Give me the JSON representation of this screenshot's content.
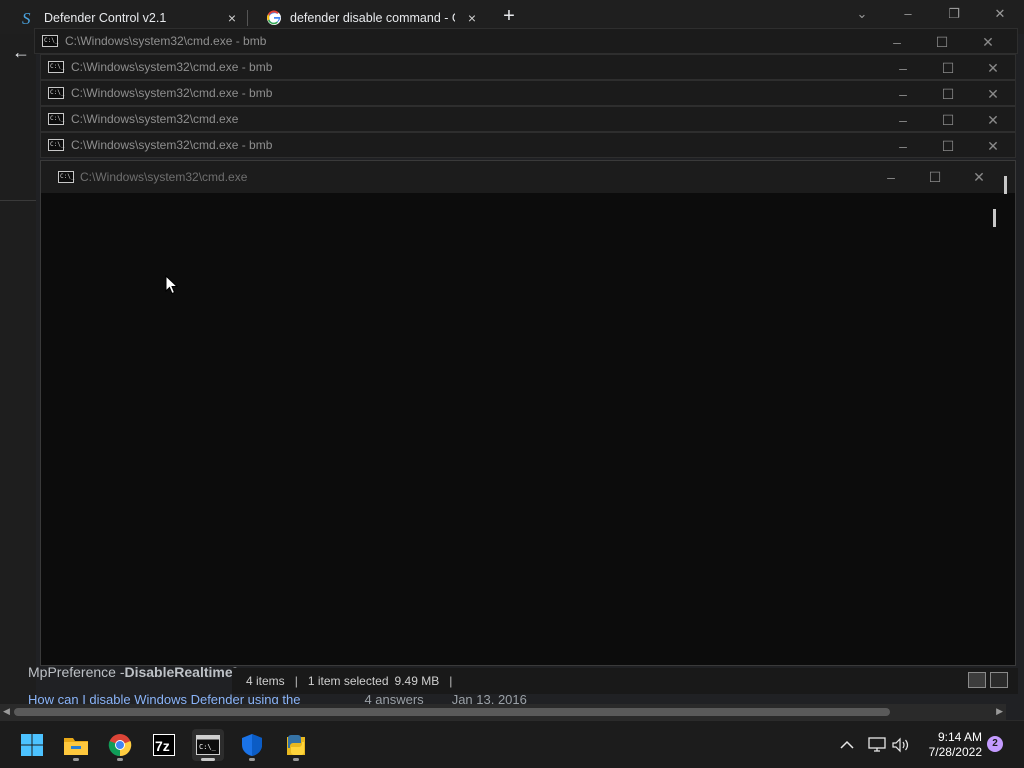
{
  "browser": {
    "tabs": [
      {
        "title": "Defender Control v2.1",
        "close": "×"
      },
      {
        "title": "defender disable command - Goo",
        "close": "×"
      }
    ],
    "new_tab": "+",
    "controls": {
      "dropdown": "⌄",
      "minimize": "–",
      "maximize": "❐",
      "close": "✕"
    },
    "back": "←",
    "page": {
      "snippet_prefix": "MpPreference -",
      "snippet_bold": "DisableRealtimeM",
      "link_text": "How can I disable Windows Defender using the",
      "answers": "4 answers",
      "date": "Jan 13, 2016"
    }
  },
  "explorer_status": {
    "items": "4 items",
    "selected": "1 item selected",
    "size": "9.49 MB",
    "separator": "|"
  },
  "console_windows": [
    {
      "title": "C:\\Windows\\system32\\cmd.exe - bmb"
    },
    {
      "title": "C:\\Windows\\system32\\cmd.exe - bmb"
    },
    {
      "title": "C:\\Windows\\system32\\cmd.exe - bmb"
    },
    {
      "title": "C:\\Windows\\system32\\cmd.exe"
    },
    {
      "title": "C:\\Windows\\system32\\cmd.exe - bmb"
    }
  ],
  "active_console": {
    "title": "C:\\Windows\\system32\\cmd.exe"
  },
  "window_controls": {
    "minimize": "–",
    "maximize": "☐",
    "close": "✕"
  },
  "cmd_icon_text": "C:\\_",
  "taskbar": {
    "apps": [
      {
        "name": "Start",
        "icon": "windows-logo-icon"
      },
      {
        "name": "File Explorer",
        "icon": "folder-icon"
      },
      {
        "name": "Google Chrome",
        "icon": "chrome-icon"
      },
      {
        "name": "7-Zip",
        "icon": "7zip-icon",
        "label": "7z"
      },
      {
        "name": "Command Prompt",
        "icon": "cmd-icon"
      },
      {
        "name": "Windows Security",
        "icon": "shield-icon"
      },
      {
        "name": "Python",
        "icon": "python-icon"
      }
    ],
    "tray": {
      "chevron": "^",
      "time": "9:14 AM",
      "date": "7/28/2022",
      "notifications": "2"
    }
  },
  "colors": {
    "accent_blue": "#4cc2ff",
    "chrome_link": "#8ab4f8",
    "badge": "#c49bff"
  }
}
